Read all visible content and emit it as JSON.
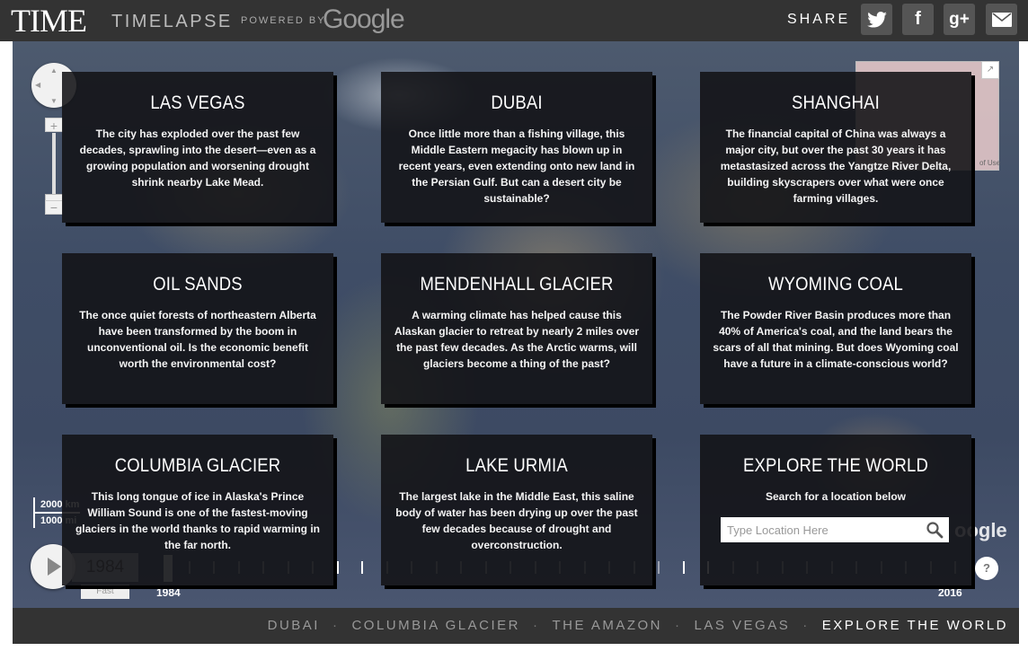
{
  "header": {
    "logo": "TIME",
    "product": "TIMELAPSE",
    "powered_by": "POWERED BY",
    "google": "Google",
    "share_label": "SHARE",
    "share_buttons": [
      {
        "name": "twitter-icon",
        "glyph": "🐦"
      },
      {
        "name": "facebook-icon",
        "glyph": "f"
      },
      {
        "name": "google-plus-icon",
        "glyph": "g+"
      },
      {
        "name": "email-icon",
        "glyph": "✉"
      }
    ]
  },
  "map": {
    "zoom_in": "+",
    "zoom_out": "−",
    "scale_top": "2000 km",
    "scale_bottom": "1000 mi",
    "watermark": "oogle",
    "terms": "of Use"
  },
  "timeline": {
    "current_year": "1984",
    "speed": "Fast",
    "start_year": "1984",
    "end_year": "2016",
    "help": "?"
  },
  "cards": [
    {
      "title": "LAS VEGAS",
      "body": "The city has exploded over the past few decades, sprawling into the desert—even as a growing population and worsening drought shrink nearby Lake Mead."
    },
    {
      "title": "DUBAI",
      "body": "Once little more than a fishing village, this Middle Eastern megacity has blown up in recent years, even extending onto new land in the Persian Gulf. But can a desert city be sustainable?"
    },
    {
      "title": "SHANGHAI",
      "body": "The financial capital of China was always a major city, but over the past 30 years it has metastasized across the Yangtze River Delta, building skyscrapers over what were once farming villages."
    },
    {
      "title": "OIL SANDS",
      "body": "The once quiet forests of northeastern Alberta have been transformed by the boom in unconventional oil. Is the economic benefit worth the environmental cost?"
    },
    {
      "title": "MENDENHALL GLACIER",
      "body": "A warming climate has helped cause this Alaskan glacier to retreat by nearly 2 miles over the past few decades. As the Arctic warms, will glaciers become a thing of the past?"
    },
    {
      "title": "WYOMING COAL",
      "body": "The Powder River Basin produces more than 40% of America's coal, and the land bears the scars of all that mining. But does Wyoming coal have a future in a climate-conscious world?"
    },
    {
      "title": "COLUMBIA GLACIER",
      "body": "This long tongue of ice in Alaska's Prince William Sound is one of the fastest-moving glaciers in the world thanks to rapid warming in the far north."
    },
    {
      "title": "LAKE URMIA",
      "body": "The largest lake in the Middle East, this saline body of water has been drying up over the past few decades because of drought and overconstruction."
    }
  ],
  "explore": {
    "title": "EXPLORE THE WORLD",
    "subtitle": "Search for a location below",
    "placeholder": "Type Location Here"
  },
  "footer": {
    "links": [
      "DUBAI",
      "COLUMBIA GLACIER",
      "THE AMAZON",
      "LAS VEGAS",
      "EXPLORE THE WORLD"
    ],
    "separator": "·",
    "active": "EXPLORE THE WORLD"
  }
}
